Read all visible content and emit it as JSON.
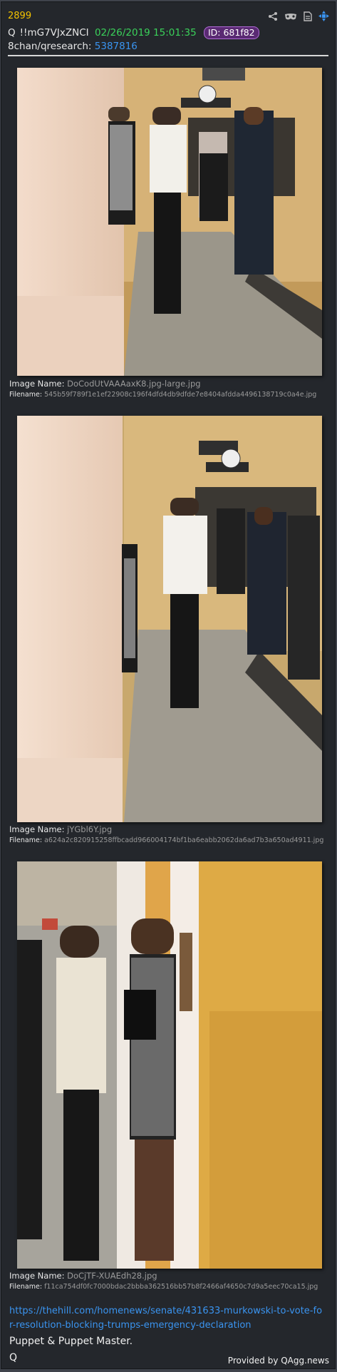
{
  "post": {
    "number": "2899",
    "q_mark": "Q",
    "tripcode": "!!mG7VJxZNCI",
    "date": "02/26/2019 15:01:35",
    "id_badge": "ID: 681f82",
    "board": "8chan/qresearch:",
    "thread_link": "5387816"
  },
  "icons": [
    "share-icon",
    "mask-icon",
    "document-icon",
    "crosshair-icon"
  ],
  "images": [
    {
      "name_label": "Image Name:",
      "name": "DoCodUtVAAAaxK8.jpg-large.jpg",
      "filename_label": "Filename:",
      "filename": "545b59f789f1e1ef22908c196f4dfd4db9dfde7e8404afdda4496138719c0a4e.jpg"
    },
    {
      "name_label": "Image Name:",
      "name": "jYGbl6Y.jpg",
      "filename_label": "Filename:",
      "filename": "a624a2c820915258ffbcadd966004174bf1ba6eabb2062da6ad7b3a650ad4911.jpg"
    },
    {
      "name_label": "Image Name:",
      "name": "DoCjTF-XUAEdh28.jpg",
      "filename_label": "Filename:",
      "filename": "f11ca754df0fc7000bdac2bbba362516bb57b8f2466af4650c7d9a5eec70ca15.jpg"
    }
  ],
  "body": {
    "url": "https://thehill.com/homenews/senate/431633-murkowski-to-vote-for-resolution-blocking-trumps-emergency-declaration",
    "message": "Puppet & Puppet Master.",
    "signature": "Q"
  },
  "footer": {
    "provided_by": "Provided by QAgg.news"
  },
  "colors": {
    "background": "#24272c",
    "post_number": "#f2c200",
    "date": "#3ad15a",
    "link": "#3a94f0",
    "id_badge": "#5a2a73"
  }
}
